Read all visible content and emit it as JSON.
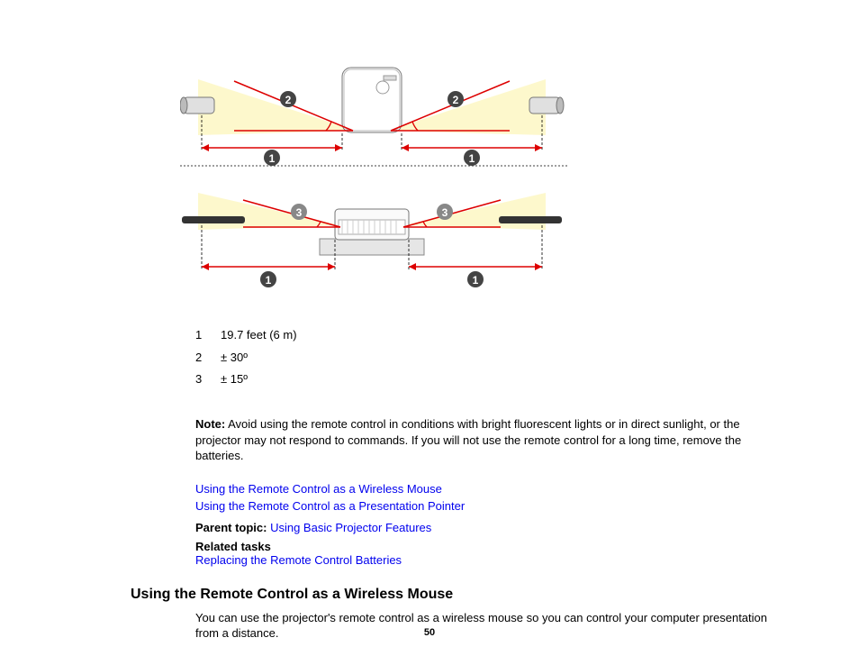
{
  "legend": {
    "items": [
      {
        "num": "1",
        "text": "19.7 feet (6 m)"
      },
      {
        "num": "2",
        "text": "± 30º"
      },
      {
        "num": "3",
        "text": "± 15º"
      }
    ]
  },
  "note": {
    "label": "Note:",
    "body": " Avoid using the remote control in conditions with bright fluorescent lights or in direct sunlight, or the projector may not respond to commands. If you will not use the remote control for a long time, remove the batteries."
  },
  "links": {
    "link1": "Using the Remote Control as a Wireless Mouse",
    "link2": "Using the Remote Control as a Presentation Pointer"
  },
  "parent_topic": {
    "label": "Parent topic: ",
    "link": "Using Basic Projector Features"
  },
  "related": {
    "label": "Related tasks",
    "link1": "Replacing the Remote Control Batteries"
  },
  "section": {
    "heading": "Using the Remote Control as a Wireless Mouse",
    "body": "You can use the projector's remote control as a wireless mouse so you can control your computer presentation from a distance."
  },
  "page_number": "50",
  "diagram": {
    "callouts": {
      "c1": "1",
      "c2": "2",
      "c3": "3"
    }
  }
}
